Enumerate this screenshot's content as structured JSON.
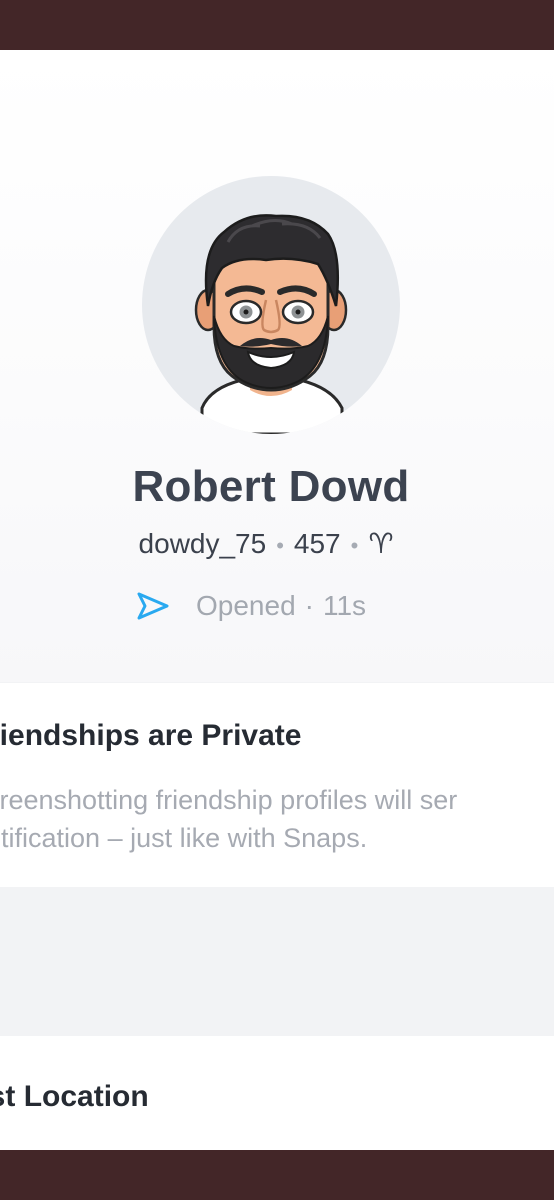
{
  "profile": {
    "display_name": "Robert Dowd",
    "username": "dowdy_75",
    "snap_score": "457",
    "zodiac_symbol": "♈",
    "status": "Opened",
    "status_time": "11s",
    "status_icon": "sent-arrow-icon",
    "status_color": "#29a9f0"
  },
  "privacy_card": {
    "title": "riendships are Private",
    "line1": "creenshotting friendship profiles will ser",
    "line2": "otification – just like with Snaps."
  },
  "location_card": {
    "title": "est Location"
  },
  "colors": {
    "frame": "#432628",
    "background": "#f2f3f5",
    "card": "#ffffff",
    "title_text": "#3c4350",
    "muted_text": "#a6aab2"
  }
}
